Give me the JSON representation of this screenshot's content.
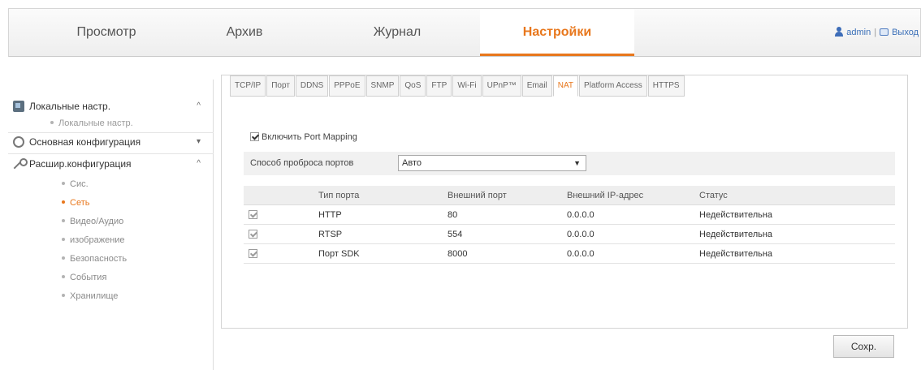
{
  "nav": {
    "tabs": [
      "Просмотр",
      "Архив",
      "Журнал",
      "Настройки"
    ],
    "active_tab": "Настройки",
    "user": "admin",
    "logout": "Выход"
  },
  "sidebar": {
    "local_group": "Локальные настр.",
    "local_items": [
      "Локальные настр."
    ],
    "basic_group": "Основная конфигурация",
    "advanced_group": "Расшир.конфигурация",
    "advanced_items": [
      "Сис.",
      "Сеть",
      "Видео/Аудио",
      "изображение",
      "Безопасность",
      "События",
      "Хранилище"
    ],
    "active_item": "Сеть"
  },
  "subtabs": [
    "TCP/IP",
    "Порт",
    "DDNS",
    "PPPoE",
    "SNMP",
    "QoS",
    "FTP",
    "Wi-Fi",
    "UPnP™",
    "Email",
    "NAT",
    "Platform Access",
    "HTTPS"
  ],
  "active_subtab": "NAT",
  "nat": {
    "enable_label": "Включить Port Mapping",
    "enable_checked": true,
    "method_label": "Способ проброса портов",
    "method_value": "Авто",
    "columns": [
      "",
      "Тип порта",
      "Внешний порт",
      "Внешний IP-адрес",
      "Статус"
    ],
    "rows": [
      {
        "checked": true,
        "type": "HTTP",
        "port": "80",
        "ip": "0.0.0.0",
        "status": "Недействительна"
      },
      {
        "checked": true,
        "type": "RTSP",
        "port": "554",
        "ip": "0.0.0.0",
        "status": "Недействительна"
      },
      {
        "checked": true,
        "type": "Порт SDK",
        "port": "8000",
        "ip": "0.0.0.0",
        "status": "Недействительна"
      }
    ]
  },
  "save_label": "Сохр.",
  "colors": {
    "accent": "#e8771c",
    "link": "#3a6fb8"
  }
}
